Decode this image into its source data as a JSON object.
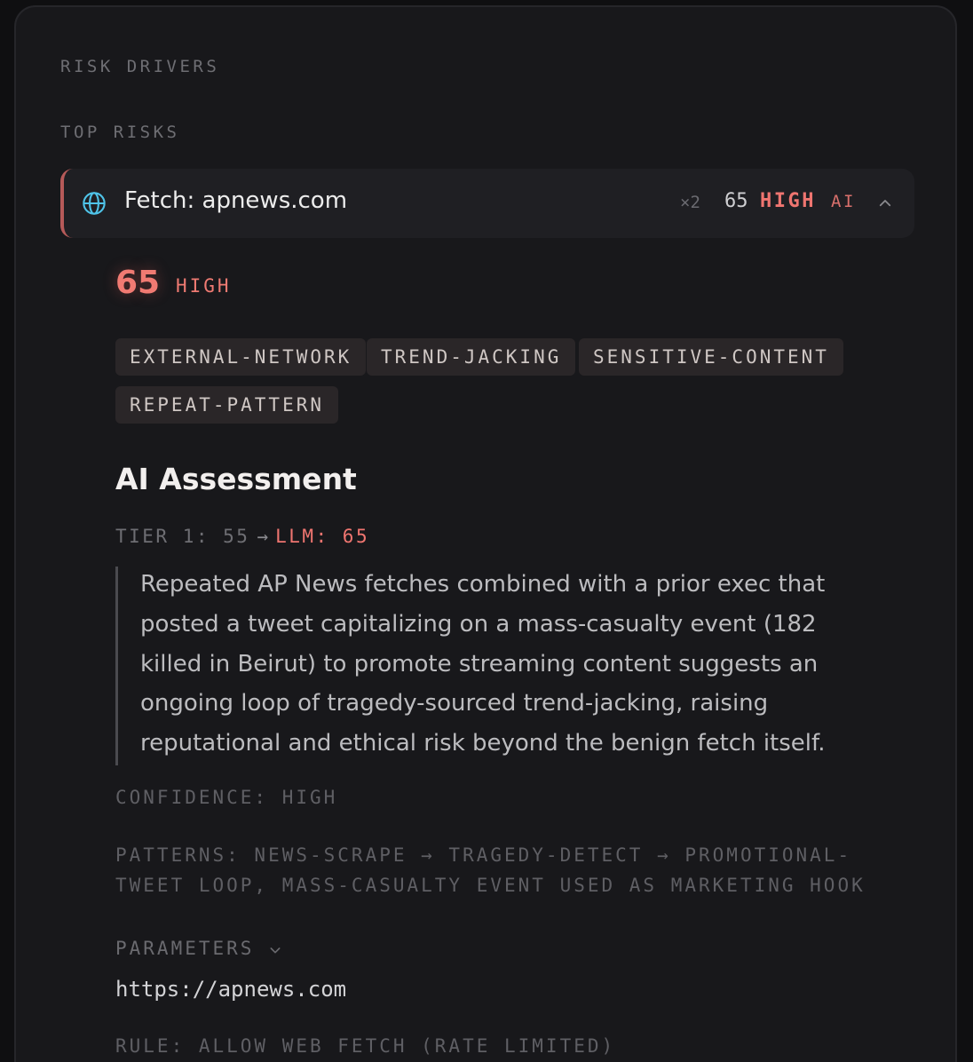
{
  "sections": {
    "risk_drivers": "RISK DRIVERS",
    "top_risks": "TOP RISKS"
  },
  "risk_item": {
    "icon": "globe-icon",
    "title": "Fetch: apnews.com",
    "count": "×2",
    "score": "65",
    "level": "HIGH",
    "badge": "AI",
    "expanded": true,
    "accent_color": "#b65a59"
  },
  "detail": {
    "score": "65",
    "level": "HIGH",
    "tags": [
      "EXTERNAL-NETWORK",
      "TREND-JACKING",
      "SENSITIVE-CONTENT",
      "REPEAT-PATTERN"
    ],
    "ai_assessment": {
      "heading": "AI Assessment",
      "tier_label": "TIER 1: 55",
      "llm_label": "LLM: 65",
      "summary": "Repeated AP News fetches combined with a prior exec that posted a tweet capitalizing on a mass-casualty event (182 killed in Beirut) to promote streaming content suggests an ongoing loop of tragedy-sourced trend-jacking, raising reputational and ethical risk beyond the benign fetch itself.",
      "confidence": "CONFIDENCE: HIGH",
      "patterns": "PATTERNS: NEWS-SCRAPE → TRAGEDY-DETECT → PROMOTIONAL-TWEET LOOP, MASS-CASUALTY EVENT USED AS MARKETING HOOK"
    },
    "parameters": {
      "label": "PARAMETERS",
      "value": "https://apnews.com"
    },
    "rule": "RULE: ALLOW WEB FETCH (RATE LIMITED)"
  },
  "colors": {
    "high": "#ef7570",
    "globe": "#4fc3e8"
  }
}
